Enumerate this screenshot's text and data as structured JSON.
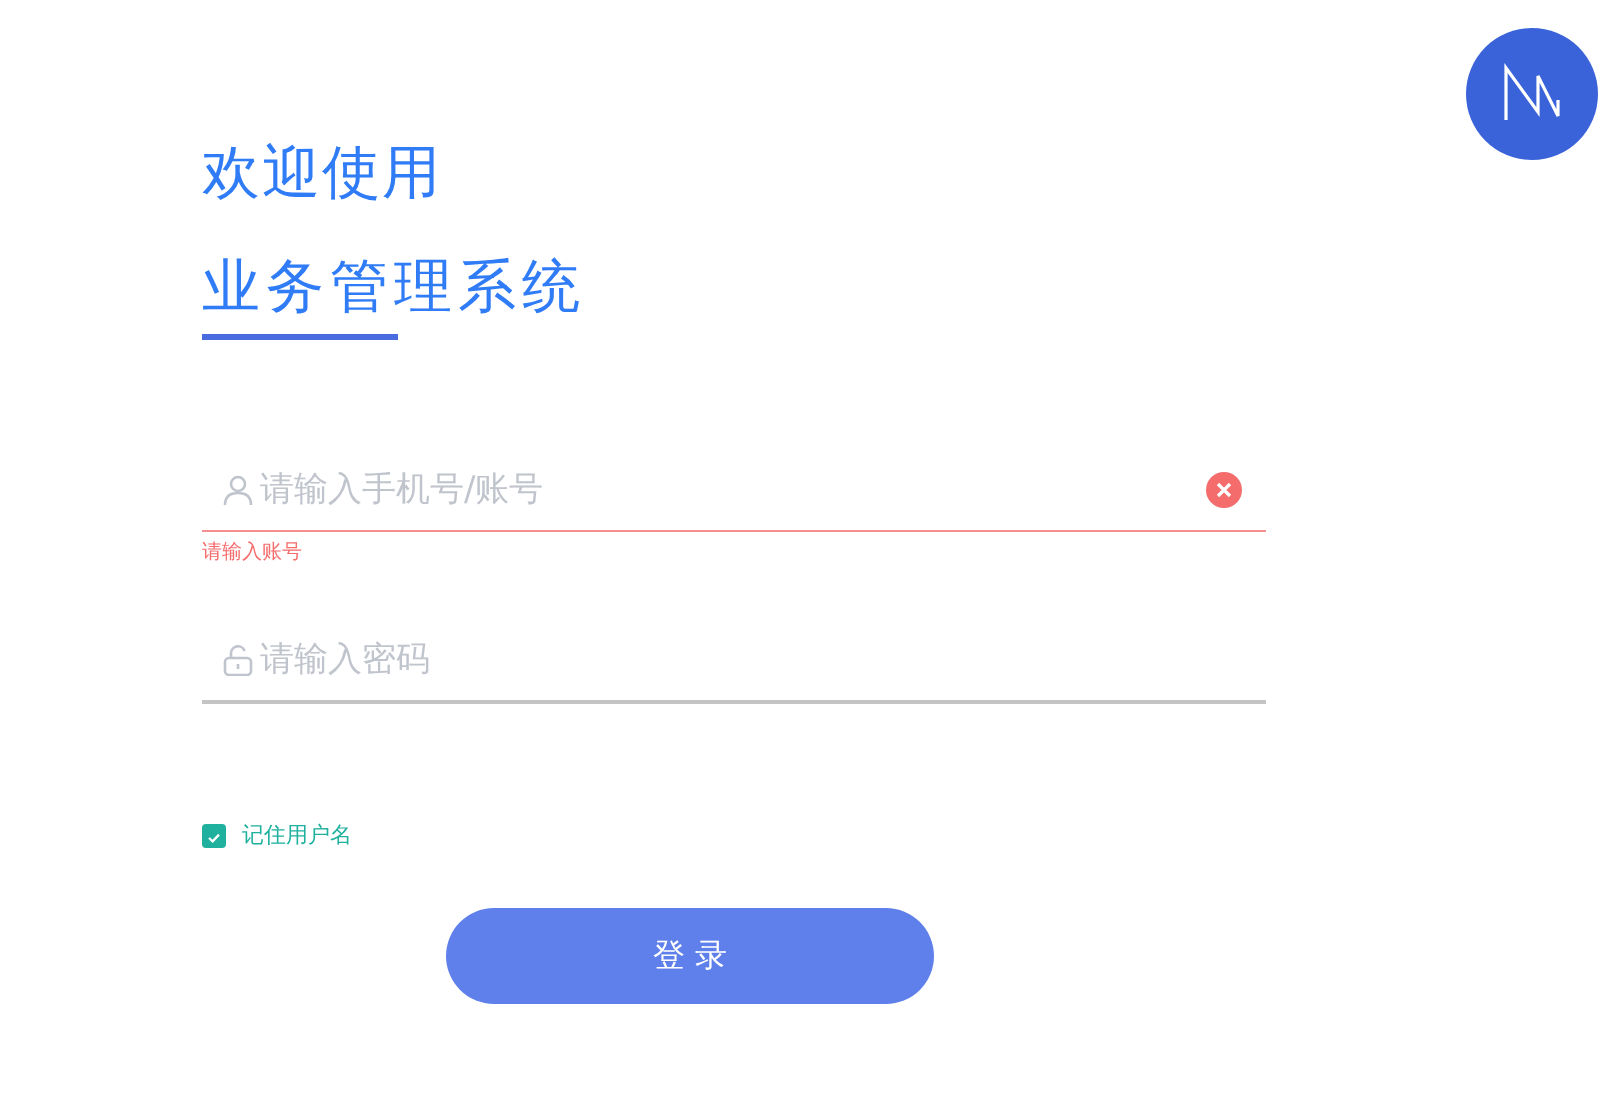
{
  "heading": {
    "line_1": "欢迎使用",
    "line_2": "业务管理系统"
  },
  "fields": [
    {
      "kind": "account",
      "placeholder": "请输入手机号/账号",
      "invalid": true,
      "clear_button": true,
      "error": "请输入账号"
    },
    {
      "kind": "password",
      "placeholder": "请输入密码",
      "invalid": false,
      "clear_button": false
    }
  ],
  "remember": {
    "label": "记住用户名",
    "checked": true
  },
  "login_button": "登 录"
}
